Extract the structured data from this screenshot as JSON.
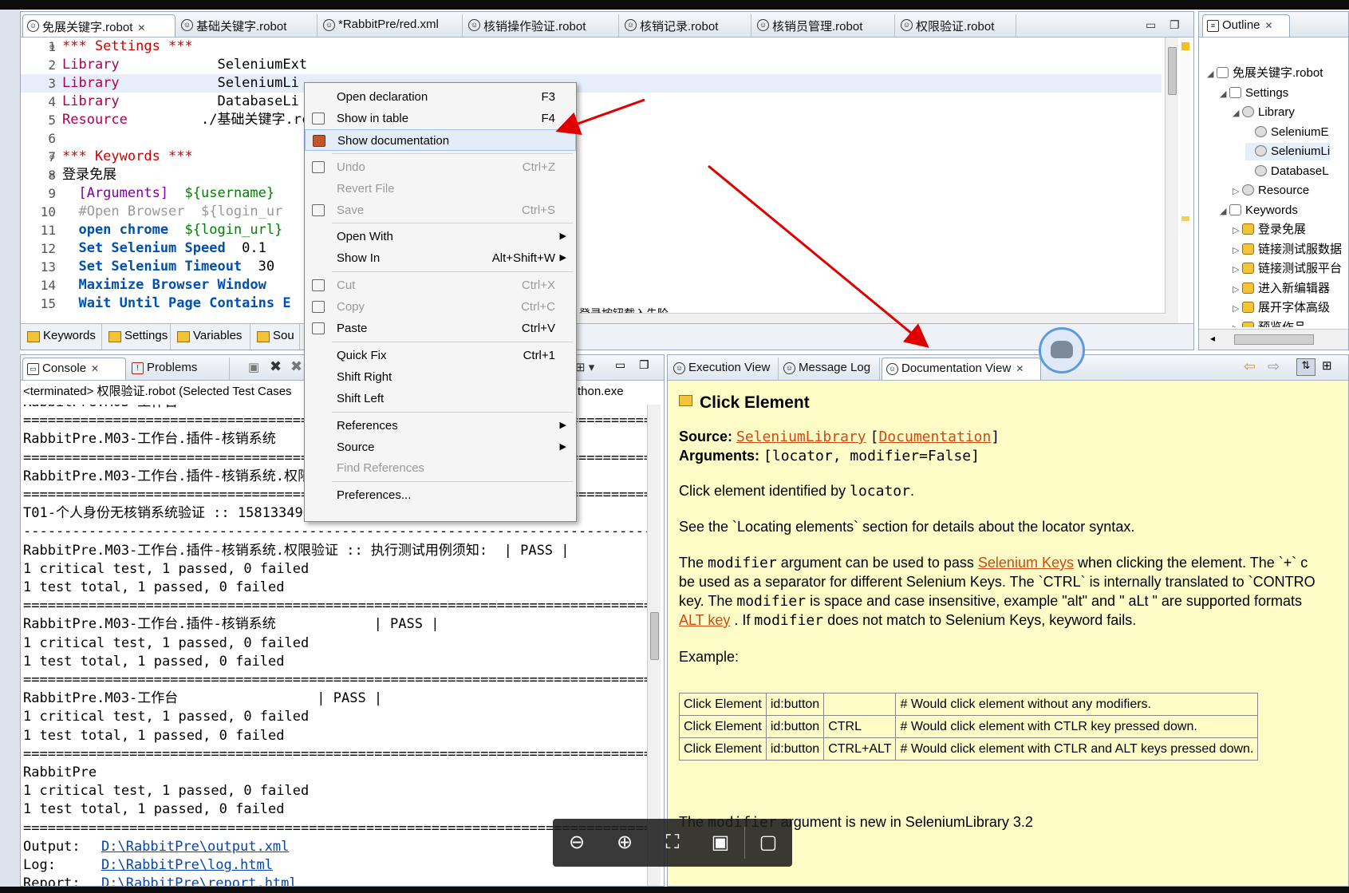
{
  "editor": {
    "tabs": [
      {
        "label": "免展关键字.robot",
        "active": true,
        "closable": true
      },
      {
        "label": "基础关键字.robot"
      },
      {
        "label": "*RabbitPre/red.xml"
      },
      {
        "label": "核销操作验证.robot"
      },
      {
        "label": "核销记录.robot"
      },
      {
        "label": "核销员管理.robot"
      },
      {
        "label": "权限验证.robot"
      }
    ],
    "lines": [
      {
        "n": "1",
        "segs": [
          {
            "t": "*** Settings ***",
            "c": "kw-set"
          }
        ]
      },
      {
        "n": "2",
        "segs": [
          {
            "t": "Library",
            "c": "kw-red"
          },
          {
            "t": "            SeleniumExt",
            "c": ""
          }
        ]
      },
      {
        "n": "3",
        "segs": [
          {
            "t": "Library",
            "c": "kw-red"
          },
          {
            "t": "            SeleniumLi",
            "c": ""
          }
        ]
      },
      {
        "n": "4",
        "segs": [
          {
            "t": "Library",
            "c": "kw-red"
          },
          {
            "t": "            DatabaseLi",
            "c": ""
          }
        ]
      },
      {
        "n": "5",
        "segs": [
          {
            "t": "Resource",
            "c": "kw-red"
          },
          {
            "t": "         ./基础关键字.rc",
            "c": ""
          }
        ]
      },
      {
        "n": "6",
        "segs": []
      },
      {
        "n": "7",
        "segs": [
          {
            "t": "*** Keywords ***",
            "c": "kw-set"
          }
        ]
      },
      {
        "n": "8",
        "segs": [
          {
            "t": "登录免展",
            "c": ""
          }
        ]
      },
      {
        "n": "9",
        "segs": [
          {
            "t": "  [Arguments]",
            "c": "kw-purple"
          },
          {
            "t": "  ${username}",
            "c": "kw-green"
          }
        ]
      },
      {
        "n": "10",
        "segs": [
          {
            "t": "  #Open Browser  ${login_ur",
            "c": "kw-gray"
          }
        ]
      },
      {
        "n": "11",
        "segs": [
          {
            "t": "  open chrome",
            "c": "kw-blue"
          },
          {
            "t": "  ${login_url}",
            "c": "kw-green"
          }
        ]
      },
      {
        "n": "12",
        "segs": [
          {
            "t": "  Set Selenium Speed",
            "c": "kw-blue"
          },
          {
            "t": "  0.1",
            "c": ""
          }
        ]
      },
      {
        "n": "13",
        "segs": [
          {
            "t": "  Set Selenium Timeout",
            "c": "kw-blue"
          },
          {
            "t": "  30",
            "c": ""
          }
        ]
      },
      {
        "n": "14",
        "segs": [
          {
            "t": "  Maximize Browser Window",
            "c": "kw-blue"
          }
        ]
      },
      {
        "n": "15",
        "segs": [
          {
            "t": "  Wait Until Page Contains E",
            "c": "kw-blue"
          }
        ]
      }
    ],
    "trailing_text": "登录按钮载入先阶",
    "bottom_tabs": [
      "Keywords",
      "Settings",
      "Variables",
      "Sou"
    ]
  },
  "outline": {
    "title": "Outline",
    "nodes": [
      {
        "label": "免展关键字.robot",
        "depth": 0,
        "tri": "◢",
        "icon": "robot"
      },
      {
        "label": "Settings",
        "depth": 1,
        "tri": "◢",
        "icon": "tbl"
      },
      {
        "label": "Library",
        "depth": 2,
        "tri": "◢",
        "icon": "gear"
      },
      {
        "label": "SeleniumE",
        "depth": 3,
        "tri": "",
        "icon": "gear"
      },
      {
        "label": "SeleniumLi",
        "depth": 3,
        "tri": "",
        "icon": "gear"
      },
      {
        "label": "DatabaseL",
        "depth": 3,
        "tri": "",
        "icon": "gear"
      },
      {
        "label": "Resource",
        "depth": 2,
        "tri": "▷",
        "icon": "gear"
      },
      {
        "label": "Keywords",
        "depth": 1,
        "tri": "◢",
        "icon": "tbl"
      },
      {
        "label": "登录免展",
        "depth": 2,
        "tri": "▷",
        "icon": "kw"
      },
      {
        "label": "链接测试服数据",
        "depth": 2,
        "tri": "▷",
        "icon": "kw"
      },
      {
        "label": "链接测试服平台",
        "depth": 2,
        "tri": "▷",
        "icon": "kw"
      },
      {
        "label": "进入新编辑器",
        "depth": 2,
        "tri": "▷",
        "icon": "kw"
      },
      {
        "label": "展开字体高级",
        "depth": 2,
        "tri": "▷",
        "icon": "kw"
      },
      {
        "label": "预览作品",
        "depth": 2,
        "tri": "▷",
        "icon": "kw"
      }
    ]
  },
  "context_menu": {
    "items": [
      {
        "label": "Open declaration",
        "shortcut": "F3"
      },
      {
        "label": "Show in table",
        "shortcut": "F4",
        "icon": true
      },
      {
        "label": "Show documentation",
        "shortcut": "",
        "selected": true,
        "icon": true
      },
      {
        "sep": true
      },
      {
        "label": "Undo",
        "shortcut": "Ctrl+Z",
        "disabled": true,
        "icon": true
      },
      {
        "label": "Revert File",
        "shortcut": "",
        "disabled": true
      },
      {
        "label": "Save",
        "shortcut": "Ctrl+S",
        "disabled": true,
        "icon": true
      },
      {
        "sep": true
      },
      {
        "label": "Open With",
        "shortcut": "",
        "submenu": true
      },
      {
        "label": "Show In",
        "shortcut": "Alt+Shift+W",
        "submenu": true
      },
      {
        "sep": true
      },
      {
        "label": "Cut",
        "shortcut": "Ctrl+X",
        "disabled": true,
        "icon": true
      },
      {
        "label": "Copy",
        "shortcut": "Ctrl+C",
        "disabled": true,
        "icon": true
      },
      {
        "label": "Paste",
        "shortcut": "Ctrl+V",
        "icon": true
      },
      {
        "sep": true
      },
      {
        "label": "Quick Fix",
        "shortcut": "Ctrl+1"
      },
      {
        "label": "Shift Right",
        "shortcut": ""
      },
      {
        "label": "Shift Left",
        "shortcut": ""
      },
      {
        "sep": true
      },
      {
        "label": "References",
        "shortcut": "",
        "submenu": true
      },
      {
        "label": "Source",
        "shortcut": "",
        "submenu": true
      },
      {
        "label": "Find References",
        "shortcut": "",
        "disabled": true
      },
      {
        "sep": true
      },
      {
        "label": "Preferences...",
        "shortcut": ""
      }
    ]
  },
  "console": {
    "tabs": [
      "Console",
      "Problems"
    ],
    "status": "<terminated> 权限验证.robot (Selected Test Cases",
    "status_right": "thon.exe",
    "lines": [
      "RabbitPre.M03-工作台",
      "==============================================================================",
      "RabbitPre.M03-工作台.插件-核销系统",
      "==============================================================================",
      "RabbitPre.M03-工作台.插件-核销系统.权限验",
      "==============================================================================",
      "T01-个人身份无核销系统验证 :: 1581334962",
      "------------------------------------------------------------------------------",
      "RabbitPre.M03-工作台.插件-核销系统.权限验证 :: 执行测试用例须知:  | PASS |",
      "1 critical test, 1 passed, 0 failed",
      "1 test total, 1 passed, 0 failed",
      "==============================================================================",
      "RabbitPre.M03-工作台.插件-核销系统            | PASS |",
      "1 critical test, 1 passed, 0 failed",
      "1 test total, 1 passed, 0 failed",
      "==============================================================================",
      "RabbitPre.M03-工作台                 | PASS |",
      "1 critical test, 1 passed, 0 failed",
      "1 test total, 1 passed, 0 failed",
      "==============================================================================",
      "RabbitPre",
      "1 critical test, 1 passed, 0 failed",
      "1 test total, 1 passed, 0 failed",
      "=============================================================================="
    ],
    "output_label": "Output:",
    "output_path": "D:\\RabbitPre\\output.xml",
    "log_label": "Log:",
    "log_path": "D:\\RabbitPre\\log.html",
    "report_label": "Report:",
    "report_path": "D:\\RabbitPre\\report.html"
  },
  "docview": {
    "tabs": [
      "Execution View",
      "Message Log",
      "Documentation View"
    ],
    "title": "Click Element",
    "source_label": "Source:",
    "source_lib": "SeleniumLibrary",
    "source_doc": "Documentation",
    "args_label": "Arguments:",
    "args": "[locator, modifier=False]",
    "p1_a": "Click element identified by ",
    "p1_code": "locator",
    "p1_b": ".",
    "p2": "See the `Locating elements` section for details about the locator syntax.",
    "p3_a": "The ",
    "p3_code": "modifier",
    "p3_b": " argument can be used to pass ",
    "p3_link": "Selenium Keys",
    "p3_c": " when clicking the element. The `+` c",
    "p4": "be used as a separator for different Selenium Keys. The `CTRL` is internally translated to `CONTRO",
    "p5_a": "key. The ",
    "p5_code": "modifier",
    "p5_b": " is space and case insensitive, example \"alt\" and \" aLt \" are supported formats",
    "p6_link": "ALT key",
    "p6_a": " . If ",
    "p6_code": "modifier",
    "p6_b": " does not match to Selenium Keys, keyword fails.",
    "example_label": "Example:",
    "table": [
      [
        "Click Element",
        "id:button",
        "",
        "# Would click element without any modifiers."
      ],
      [
        "Click Element",
        "id:button",
        "CTRL",
        "# Would click element with CTLR key pressed down."
      ],
      [
        "Click Element",
        "id:button",
        "CTRL+ALT",
        "# Would click element with CTLR and ALT keys pressed down."
      ]
    ],
    "p7_a": "The ",
    "p7_code": "modifier",
    "p7_b": " argument is new in SeleniumLibrary 3.2"
  },
  "viewer_toolbar": {
    "zoom_out_icon": "⊖",
    "zoom_in_icon": "⊕",
    "fit_icon": "⛶",
    "present_icon": "▣",
    "comment_icon": "▢"
  },
  "colors": {
    "annotation_arrow": "#e00000",
    "doc_background": "#fdfcc6",
    "link": "#d14a14"
  }
}
